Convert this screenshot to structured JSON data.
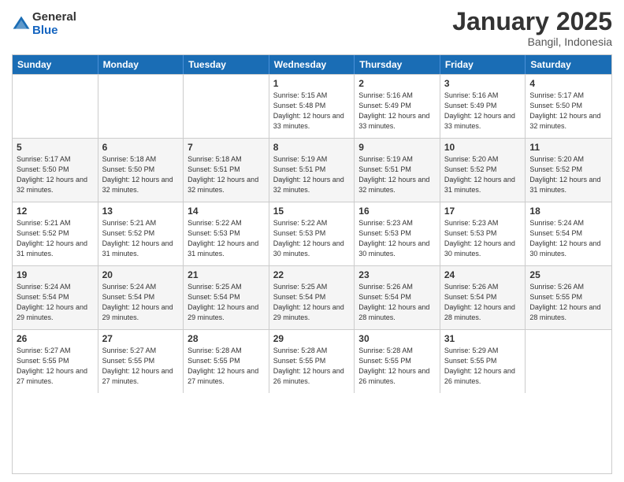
{
  "logo": {
    "general": "General",
    "blue": "Blue"
  },
  "title": "January 2025",
  "subtitle": "Bangil, Indonesia",
  "weekdays": [
    "Sunday",
    "Monday",
    "Tuesday",
    "Wednesday",
    "Thursday",
    "Friday",
    "Saturday"
  ],
  "rows": [
    [
      {
        "day": "",
        "info": ""
      },
      {
        "day": "",
        "info": ""
      },
      {
        "day": "",
        "info": ""
      },
      {
        "day": "1",
        "info": "Sunrise: 5:15 AM\nSunset: 5:48 PM\nDaylight: 12 hours\nand 33 minutes."
      },
      {
        "day": "2",
        "info": "Sunrise: 5:16 AM\nSunset: 5:49 PM\nDaylight: 12 hours\nand 33 minutes."
      },
      {
        "day": "3",
        "info": "Sunrise: 5:16 AM\nSunset: 5:49 PM\nDaylight: 12 hours\nand 33 minutes."
      },
      {
        "day": "4",
        "info": "Sunrise: 5:17 AM\nSunset: 5:50 PM\nDaylight: 12 hours\nand 32 minutes."
      }
    ],
    [
      {
        "day": "5",
        "info": "Sunrise: 5:17 AM\nSunset: 5:50 PM\nDaylight: 12 hours\nand 32 minutes."
      },
      {
        "day": "6",
        "info": "Sunrise: 5:18 AM\nSunset: 5:50 PM\nDaylight: 12 hours\nand 32 minutes."
      },
      {
        "day": "7",
        "info": "Sunrise: 5:18 AM\nSunset: 5:51 PM\nDaylight: 12 hours\nand 32 minutes."
      },
      {
        "day": "8",
        "info": "Sunrise: 5:19 AM\nSunset: 5:51 PM\nDaylight: 12 hours\nand 32 minutes."
      },
      {
        "day": "9",
        "info": "Sunrise: 5:19 AM\nSunset: 5:51 PM\nDaylight: 12 hours\nand 32 minutes."
      },
      {
        "day": "10",
        "info": "Sunrise: 5:20 AM\nSunset: 5:52 PM\nDaylight: 12 hours\nand 31 minutes."
      },
      {
        "day": "11",
        "info": "Sunrise: 5:20 AM\nSunset: 5:52 PM\nDaylight: 12 hours\nand 31 minutes."
      }
    ],
    [
      {
        "day": "12",
        "info": "Sunrise: 5:21 AM\nSunset: 5:52 PM\nDaylight: 12 hours\nand 31 minutes."
      },
      {
        "day": "13",
        "info": "Sunrise: 5:21 AM\nSunset: 5:52 PM\nDaylight: 12 hours\nand 31 minutes."
      },
      {
        "day": "14",
        "info": "Sunrise: 5:22 AM\nSunset: 5:53 PM\nDaylight: 12 hours\nand 31 minutes."
      },
      {
        "day": "15",
        "info": "Sunrise: 5:22 AM\nSunset: 5:53 PM\nDaylight: 12 hours\nand 30 minutes."
      },
      {
        "day": "16",
        "info": "Sunrise: 5:23 AM\nSunset: 5:53 PM\nDaylight: 12 hours\nand 30 minutes."
      },
      {
        "day": "17",
        "info": "Sunrise: 5:23 AM\nSunset: 5:53 PM\nDaylight: 12 hours\nand 30 minutes."
      },
      {
        "day": "18",
        "info": "Sunrise: 5:24 AM\nSunset: 5:54 PM\nDaylight: 12 hours\nand 30 minutes."
      }
    ],
    [
      {
        "day": "19",
        "info": "Sunrise: 5:24 AM\nSunset: 5:54 PM\nDaylight: 12 hours\nand 29 minutes."
      },
      {
        "day": "20",
        "info": "Sunrise: 5:24 AM\nSunset: 5:54 PM\nDaylight: 12 hours\nand 29 minutes."
      },
      {
        "day": "21",
        "info": "Sunrise: 5:25 AM\nSunset: 5:54 PM\nDaylight: 12 hours\nand 29 minutes."
      },
      {
        "day": "22",
        "info": "Sunrise: 5:25 AM\nSunset: 5:54 PM\nDaylight: 12 hours\nand 29 minutes."
      },
      {
        "day": "23",
        "info": "Sunrise: 5:26 AM\nSunset: 5:54 PM\nDaylight: 12 hours\nand 28 minutes."
      },
      {
        "day": "24",
        "info": "Sunrise: 5:26 AM\nSunset: 5:54 PM\nDaylight: 12 hours\nand 28 minutes."
      },
      {
        "day": "25",
        "info": "Sunrise: 5:26 AM\nSunset: 5:55 PM\nDaylight: 12 hours\nand 28 minutes."
      }
    ],
    [
      {
        "day": "26",
        "info": "Sunrise: 5:27 AM\nSunset: 5:55 PM\nDaylight: 12 hours\nand 27 minutes."
      },
      {
        "day": "27",
        "info": "Sunrise: 5:27 AM\nSunset: 5:55 PM\nDaylight: 12 hours\nand 27 minutes."
      },
      {
        "day": "28",
        "info": "Sunrise: 5:28 AM\nSunset: 5:55 PM\nDaylight: 12 hours\nand 27 minutes."
      },
      {
        "day": "29",
        "info": "Sunrise: 5:28 AM\nSunset: 5:55 PM\nDaylight: 12 hours\nand 26 minutes."
      },
      {
        "day": "30",
        "info": "Sunrise: 5:28 AM\nSunset: 5:55 PM\nDaylight: 12 hours\nand 26 minutes."
      },
      {
        "day": "31",
        "info": "Sunrise: 5:29 AM\nSunset: 5:55 PM\nDaylight: 12 hours\nand 26 minutes."
      },
      {
        "day": "",
        "info": ""
      }
    ]
  ]
}
